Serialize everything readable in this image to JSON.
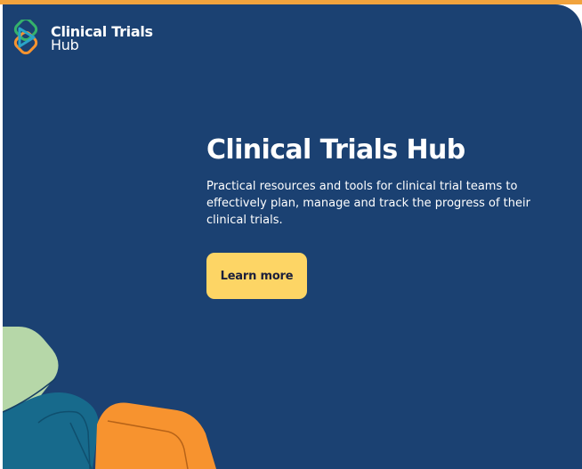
{
  "brand": {
    "name_line1": "Clinical Trials",
    "name_line2": "Hub"
  },
  "hero": {
    "title": "Clinical Trials Hub",
    "description": "Practical resources and tools for clinical trial teams to effectively plan, manage and track the progress of their clinical trials.",
    "cta_label": "Learn more"
  },
  "colors": {
    "background": "#1b4172",
    "accent_yellow": "#fdd565",
    "accent_orange": "#f7932f",
    "accent_green": "#b6d7a8",
    "accent_teal": "#176a8c"
  }
}
